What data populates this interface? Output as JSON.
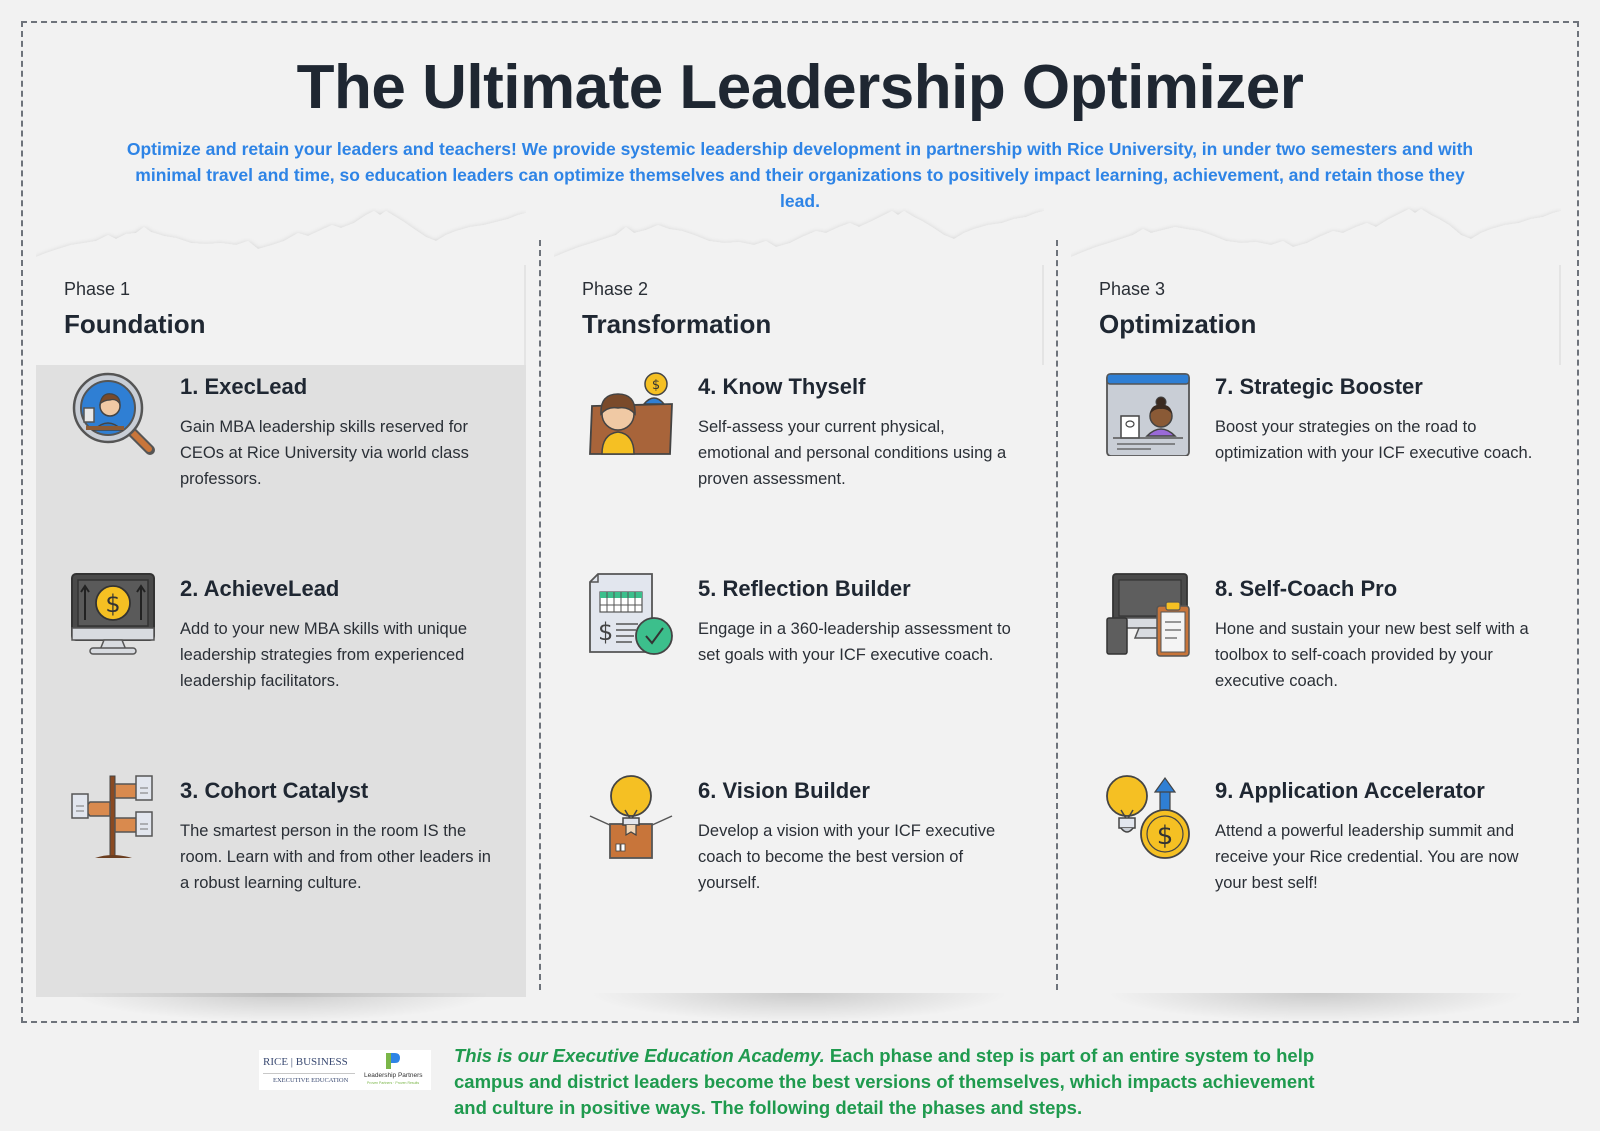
{
  "header": {
    "title": "The Ultimate Leadership Optimizer",
    "subtitle": "Optimize and retain your leaders and teachers! We provide systemic leadership development in partnership with Rice University, in under two semesters and with minimal travel and time, so education leaders can optimize themselves and their organizations to positively impact learning, achievement, and retain those they lead."
  },
  "colors": {
    "title": "#1f2732",
    "subtitle": "#2e84e6",
    "footer": "#1f9a4e",
    "phase1_panel": "#e0e0e0",
    "background": "#f2f2f2"
  },
  "phases": [
    {
      "label": "Phase 1",
      "name": "Foundation",
      "steps": [
        {
          "title": "1. ExecLead",
          "description": "Gain MBA leadership skills reserved for CEOs at Rice University via world class professors.",
          "icon": "magnifier-person-icon"
        },
        {
          "title": "2. AchieveLead",
          "description": "Add to your new MBA skills with unique leadership strategies from experienced leadership facilitators.",
          "icon": "monitor-dollar-icon"
        },
        {
          "title": "3. Cohort Catalyst",
          "description": "The smartest person in the room IS the room. Learn with and from other leaders in a robust learning culture.",
          "icon": "signpost-icon"
        }
      ]
    },
    {
      "label": "Phase 2",
      "name": "Transformation",
      "steps": [
        {
          "title": "4. Know Thyself",
          "description": "Self-assess your current physical, emotional and personal conditions using a proven assessment.",
          "icon": "person-desk-dollar-icon"
        },
        {
          "title": "5. Reflection Builder",
          "description": "Engage in a 360-leadership assessment to set goals with your ICF executive coach.",
          "icon": "document-check-icon"
        },
        {
          "title": "6. Vision Builder",
          "description": "Develop a vision with your ICF executive coach to become the best version of yourself.",
          "icon": "lightbulb-box-icon"
        }
      ]
    },
    {
      "label": "Phase 3",
      "name": "Optimization",
      "steps": [
        {
          "title": "7. Strategic Booster",
          "description": "Boost your strategies on the road to optimization with your ICF executive coach.",
          "icon": "browser-person-icon"
        },
        {
          "title": "8. Self-Coach Pro",
          "description": "Hone and sustain your new best self with a toolbox to self-coach provided by your executive coach.",
          "icon": "devices-clipboard-icon"
        },
        {
          "title": "9. Application Accelerator",
          "description": "Attend a powerful leadership summit and receive your Rice credential. You are now your best self!",
          "icon": "lightbulb-coin-arrow-icon"
        }
      ]
    }
  ],
  "footer": {
    "logos": {
      "rice": "RICE | BUSINESS",
      "rice_sub": "EXECUTIVE EDUCATION",
      "partner": "Leadership Partners",
      "partner_tag": "Proven Partners · Proven Results"
    },
    "italic_lead": "This is our Executive Education Academy.",
    "text": "  Each phase and step is part of an entire system to help campus and district leaders become the best versions of themselves, which impacts achievement and culture in positive ways.  The following detail the phases and steps."
  }
}
